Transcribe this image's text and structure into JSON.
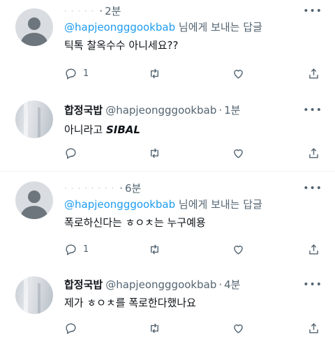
{
  "tweets": [
    {
      "name": "",
      "name_blurred": "·  ·  ·   ·  ·",
      "handle": "",
      "time": "2분",
      "reply_prefix_mention": "@hapjeongggookbab",
      "reply_suffix": " 님에게 보내는 답글",
      "text": "틱톡 찰옥수수 아니세요??",
      "actions": {
        "reply_count": "1",
        "retweet_count": "",
        "like_count": ""
      }
    },
    {
      "name": "합정국밥",
      "handle": "@hapjeongggookbab",
      "time": "1분",
      "text_prefix": "아니라고 ",
      "text_emph": "SIBAL",
      "actions": {
        "reply_count": "",
        "retweet_count": "",
        "like_count": ""
      }
    },
    {
      "name": "",
      "name_blurred": "·  ·  ·   ·  ·  ·  ·  ·",
      "handle": "",
      "time": "6분",
      "reply_prefix_mention": "@hapjeongggookbab",
      "reply_suffix": " 님에게 보내는 답글",
      "text": "폭로하신다는 ㅎㅇㅊ는 누구예용",
      "actions": {
        "reply_count": "1",
        "retweet_count": "",
        "like_count": ""
      }
    },
    {
      "name": "합정국밥",
      "handle": "@hapjeongggookbab",
      "time": "4분",
      "text": "제가 ㅎㅇㅊ를 폭로한다했나요",
      "actions": {
        "reply_count": "",
        "retweet_count": "",
        "like_count": ""
      }
    }
  ],
  "icons": [
    "reply-icon",
    "retweet-icon",
    "like-icon",
    "share-icon",
    "more-icon"
  ],
  "colors": {
    "link": "#1d9bf0",
    "secondary": "#536471",
    "primary": "#0f1419",
    "divider": "#eff3f4"
  }
}
